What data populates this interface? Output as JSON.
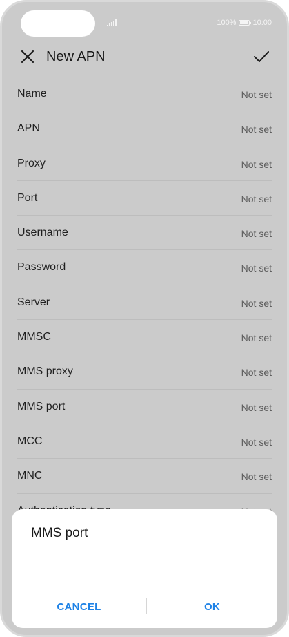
{
  "status_bar": {
    "battery_text": "100%",
    "time": "10:00"
  },
  "appbar": {
    "title": "New APN",
    "close_icon": "close-icon",
    "confirm_icon": "check-icon"
  },
  "fields": [
    {
      "label": "Name",
      "value": "Not set"
    },
    {
      "label": "APN",
      "value": "Not set"
    },
    {
      "label": "Proxy",
      "value": "Not set"
    },
    {
      "label": "Port",
      "value": "Not set"
    },
    {
      "label": "Username",
      "value": "Not set"
    },
    {
      "label": "Password",
      "value": "Not set"
    },
    {
      "label": "Server",
      "value": "Not set"
    },
    {
      "label": "MMSC",
      "value": "Not set"
    },
    {
      "label": "MMS proxy",
      "value": "Not set"
    },
    {
      "label": "MMS port",
      "value": "Not set"
    },
    {
      "label": "MCC",
      "value": "Not set"
    },
    {
      "label": "MNC",
      "value": "Not set"
    },
    {
      "label": "Authentication type",
      "value": "Not set"
    }
  ],
  "dialog": {
    "title": "MMS port",
    "input_value": "",
    "cancel_label": "CANCEL",
    "ok_label": "OK"
  },
  "colors": {
    "accent": "#1e82e6",
    "scrim": "#cbcbcb"
  }
}
